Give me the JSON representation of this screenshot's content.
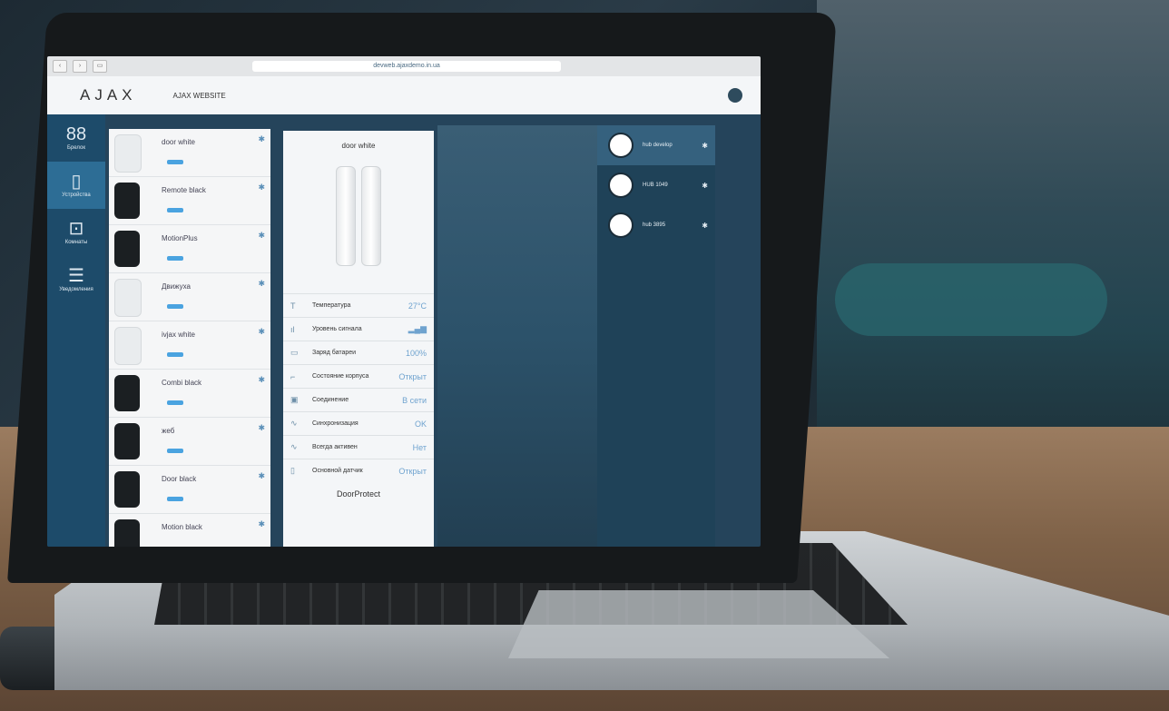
{
  "browser": {
    "url": "devweb.ajaxdemo.in.ua"
  },
  "app": {
    "logo": "AJAX",
    "site_name": "AJAX WEBSITE"
  },
  "rail": [
    {
      "label": "Брелок",
      "icon": "group-icon"
    },
    {
      "label": "Устройства",
      "icon": "devices-icon",
      "active": true
    },
    {
      "label": "Комнаты",
      "icon": "rooms-icon"
    },
    {
      "label": "Уведомления",
      "icon": "notifications-icon"
    }
  ],
  "devices": [
    {
      "name": "door white",
      "color": "white"
    },
    {
      "name": "Remote black",
      "color": "black"
    },
    {
      "name": "MotionPlus",
      "color": "black"
    },
    {
      "name": "Движуха",
      "color": "white"
    },
    {
      "name": "ivjax white",
      "color": "white"
    },
    {
      "name": "Combi black",
      "color": "black"
    },
    {
      "name": "жеб",
      "color": "black"
    },
    {
      "name": "Door black",
      "color": "black"
    },
    {
      "name": "Motion black",
      "color": "black"
    }
  ],
  "detail": {
    "title": "door white",
    "rows": [
      {
        "icon": "temperature-icon",
        "label": "Температура",
        "value": "27°C"
      },
      {
        "icon": "signal-icon",
        "label": "Уровень сигнала",
        "value": "▂▄▆"
      },
      {
        "icon": "battery-icon",
        "label": "Заряд батареи",
        "value": "100%"
      },
      {
        "icon": "tamper-icon",
        "label": "Состояние корпуса",
        "value": "Открыт"
      },
      {
        "icon": "connection-icon",
        "label": "Соединение",
        "value": "В сети"
      },
      {
        "icon": "sync-icon",
        "label": "Синхронизация",
        "value": "OK"
      },
      {
        "icon": "always-active-icon",
        "label": "Всегда активен",
        "value": "Нет"
      },
      {
        "icon": "main-sensor-icon",
        "label": "Основной датчик",
        "value": "Открыт"
      }
    ],
    "product": "DoorProtect"
  },
  "hubs": [
    {
      "name": "hub develop",
      "active": true
    },
    {
      "name": "HUB 1049"
    },
    {
      "name": "hub 3895"
    }
  ]
}
